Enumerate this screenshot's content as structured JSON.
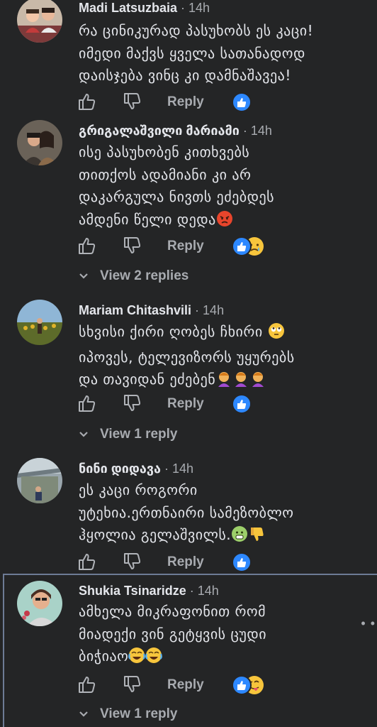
{
  "comments": [
    {
      "author": "Madi Latsuzbaia",
      "time": " · 14h",
      "lines": [
        "რა ცინიკურად პასუხობს ეს კაცი!",
        "იმედი მაქვს ყველა სათანადოდ",
        "დაისჯება ვინც კი დამნაშავეა!"
      ],
      "reply_label": "Reply",
      "reactions": [
        "like"
      ]
    },
    {
      "author": "გრიგალაშვილი მარიამი",
      "time": " · 14h",
      "lines": [
        "ისე პასუხობენ კითხვებს",
        "თითქოს ადამიანი კი არ",
        "დაკარგულა ნივთს ეძებდეს",
        "ამდენი წელი დედა"
      ],
      "reply_label": "Reply",
      "reactions": [
        "like",
        "sad"
      ],
      "view_replies": "View 2 replies"
    },
    {
      "author": "Mariam Chitashvili",
      "time": " · 14h",
      "lines": [
        "სხვისი ქირი ღობეს ჩხირი",
        "იპოვეს, ტელევიზორს უყურებს",
        "და თავიდან ეძებენ"
      ],
      "reply_label": "Reply",
      "reactions": [
        "like"
      ],
      "view_replies": "View 1 reply"
    },
    {
      "author": "ნინი დიდავა",
      "time": " · 14h",
      "lines": [
        "ეს კაცი როგორი",
        "უტეხია.ერთნაირი სამეზობლო",
        "ჰყოლია გელაშვილს."
      ],
      "reply_label": "Reply",
      "reactions": [
        "like"
      ]
    },
    {
      "author": "Shukia Tsinaridze",
      "time": " · 14h",
      "lines": [
        "ამხელა მიკრაფონით რომ",
        "მიადექი ვინ გეტყვის ცუდი",
        "ბიჭიაო"
      ],
      "reply_label": "Reply",
      "reactions": [
        "like",
        "tongue"
      ],
      "view_replies": "View 1 reply"
    }
  ],
  "colors": {
    "background": "#242526",
    "text": "#e4e6eb",
    "secondary": "#a8abb0",
    "like_blue": "#2d88ff",
    "highlight_border": "#6d7b95"
  },
  "icons": [
    "thumbs-up-icon",
    "thumbs-down-icon",
    "chevron-down-icon",
    "more-dots-icon"
  ],
  "more_menu": "• •"
}
